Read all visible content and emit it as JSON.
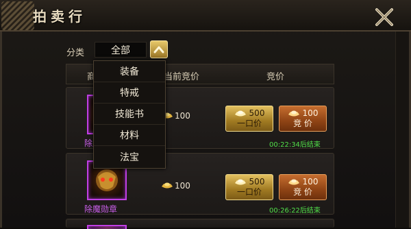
{
  "window": {
    "title": "拍卖行"
  },
  "filter": {
    "label": "分类",
    "selected": "全部"
  },
  "table": {
    "headers": {
      "item": "商",
      "current_bid": "当前竞价",
      "bid": "竞价"
    },
    "rows": [
      {
        "name": "除魔勋章",
        "current_bid": "100",
        "buyout_price": "500",
        "buyout_label": "一口价",
        "bid_price": "100",
        "bid_label": "竞 价",
        "timer": "00:22:34后结束"
      },
      {
        "name": "除魔勋章",
        "current_bid": "100",
        "buyout_price": "500",
        "buyout_label": "一口价",
        "bid_price": "100",
        "bid_label": "竞 价",
        "timer": "00:26:22后结束"
      }
    ]
  },
  "dropdown": {
    "options": [
      "装备",
      "特戒",
      "技能书",
      "材料",
      "法宝"
    ]
  },
  "colors": {
    "gold_button": "#c9a23e",
    "bid_button": "#a6521c",
    "item_border": "#c23fe6",
    "timer_green": "#52e04a"
  },
  "icons": [
    "close-x-icon",
    "chevron-up-icon",
    "gold-ingot-icon",
    "medal-icon"
  ]
}
